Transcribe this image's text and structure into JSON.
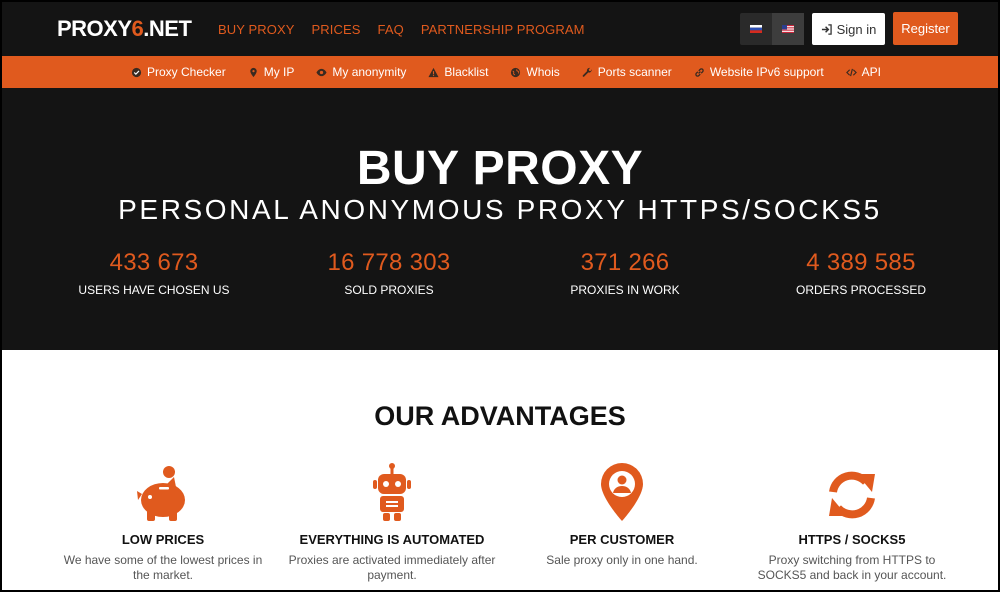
{
  "header": {
    "logo_prefix": "PROXY",
    "logo_accent": "6",
    "logo_suffix": ".NET",
    "nav": [
      "BUY PROXY",
      "PRICES",
      "FAQ",
      "PARTNERSHIP PROGRAM"
    ],
    "signin_label": "Sign in",
    "register_label": "Register",
    "languages": [
      "ru-flag-icon",
      "us-flag-icon"
    ]
  },
  "subnav": [
    {
      "label": "Proxy Checker",
      "icon": "check-shield-icon"
    },
    {
      "label": "My IP",
      "icon": "pin-icon"
    },
    {
      "label": "My anonymity",
      "icon": "eye-icon"
    },
    {
      "label": "Blacklist",
      "icon": "warning-icon"
    },
    {
      "label": "Whois",
      "icon": "globe-icon"
    },
    {
      "label": "Ports scanner",
      "icon": "wrench-icon"
    },
    {
      "label": "Website IPv6 support",
      "icon": "link-icon"
    },
    {
      "label": "API",
      "icon": "code-icon"
    }
  ],
  "hero": {
    "title": "BUY PROXY",
    "subtitle": "PERSONAL ANONYMOUS PROXY HTTPS/SOCKS5",
    "stats": [
      {
        "value": "433 673",
        "label": "USERS HAVE CHOSEN US"
      },
      {
        "value": "16 778 303",
        "label": "SOLD PROXIES"
      },
      {
        "value": "371 266",
        "label": "PROXIES IN WORK"
      },
      {
        "value": "4 389 585",
        "label": "ORDERS PROCESSED"
      }
    ]
  },
  "advantages": {
    "title": "OUR ADVANTAGES",
    "items": [
      {
        "name": "LOW PRICES",
        "desc": "We have some of the lowest prices in the market.",
        "icon": "piggy-bank-icon"
      },
      {
        "name": "EVERYTHING IS AUTOMATED",
        "desc": "Proxies are activated immediately after payment.",
        "icon": "robot-icon"
      },
      {
        "name": "PER CUSTOMER",
        "desc": "Sale proxy only in one hand.",
        "icon": "user-pin-icon"
      },
      {
        "name": "HTTPS / SOCKS5",
        "desc": "Proxy switching from HTTPS to SOCKS5 and back in your account.",
        "icon": "refresh-arrows-icon"
      }
    ]
  },
  "colors": {
    "accent": "#e05a1e",
    "dark": "#141414"
  }
}
